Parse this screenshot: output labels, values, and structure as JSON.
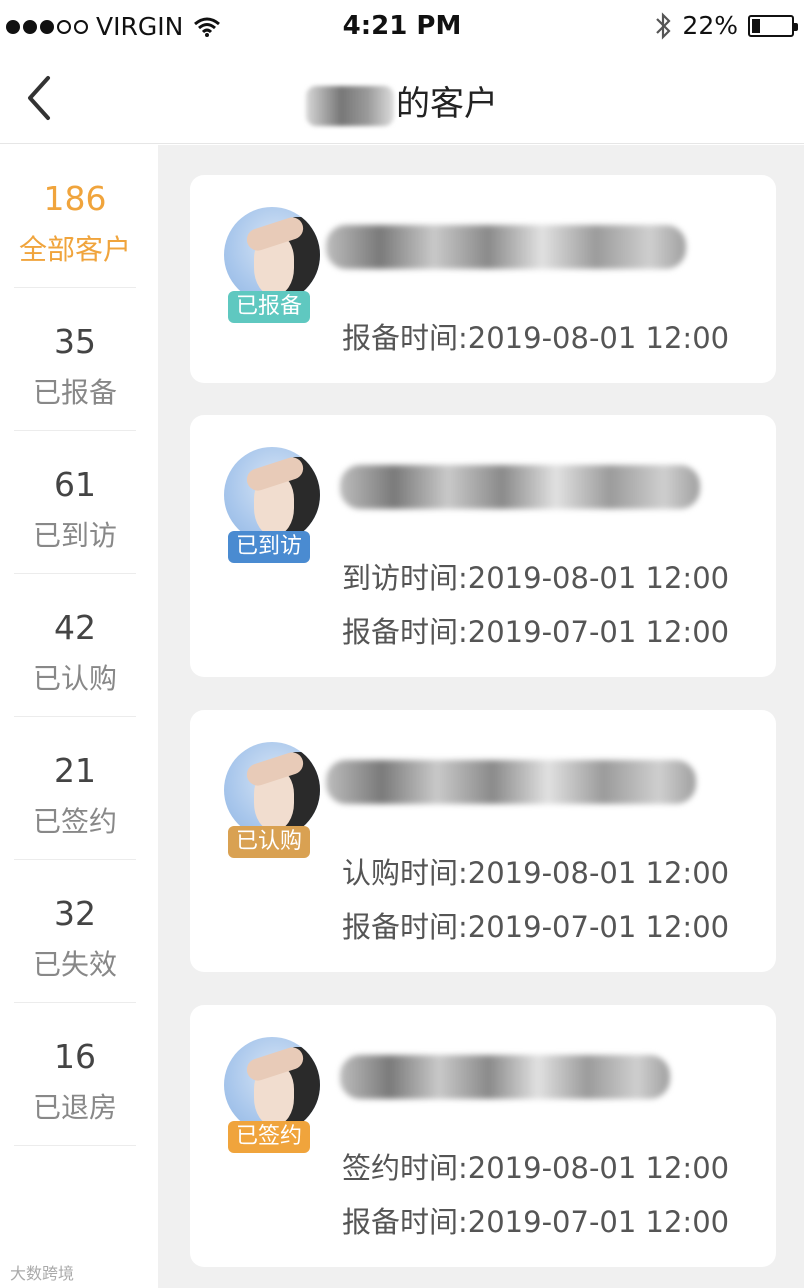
{
  "status_bar": {
    "carrier": "VIRGIN",
    "time": "4:21 PM",
    "battery_percent": "22%",
    "battery_level": 0.22,
    "signal_bars_filled": 3
  },
  "nav": {
    "title_suffix": "的客户"
  },
  "sidebar": {
    "items": [
      {
        "count": "186",
        "label": "全部客户"
      },
      {
        "count": "35",
        "label": "已报备"
      },
      {
        "count": "61",
        "label": "已到访"
      },
      {
        "count": "42",
        "label": "已认购"
      },
      {
        "count": "21",
        "label": "已签约"
      },
      {
        "count": "32",
        "label": "已失效"
      },
      {
        "count": "16",
        "label": "已退房"
      }
    ]
  },
  "cards": [
    {
      "status": "已报备",
      "status_color": "#5fc8c0",
      "lines": [
        "报备时间:2019-08-01 12:00"
      ]
    },
    {
      "status": "已到访",
      "status_color": "#4a8bd1",
      "lines": [
        "到访时间:2019-08-01 12:00",
        "报备时间:2019-07-01 12:00"
      ]
    },
    {
      "status": "已认购",
      "status_color": "#d9a152",
      "lines": [
        "认购时间:2019-08-01 12:00",
        "报备时间:2019-07-01 12:00"
      ]
    },
    {
      "status": "已签约",
      "status_color": "#f0a43c",
      "lines": [
        "签约时间:2019-08-01 12:00",
        "报备时间:2019-07-01 12:00"
      ]
    }
  ],
  "colors": {
    "accent": "#f0a43c",
    "background": "#f0f0f0"
  },
  "watermark": "大数跨境"
}
